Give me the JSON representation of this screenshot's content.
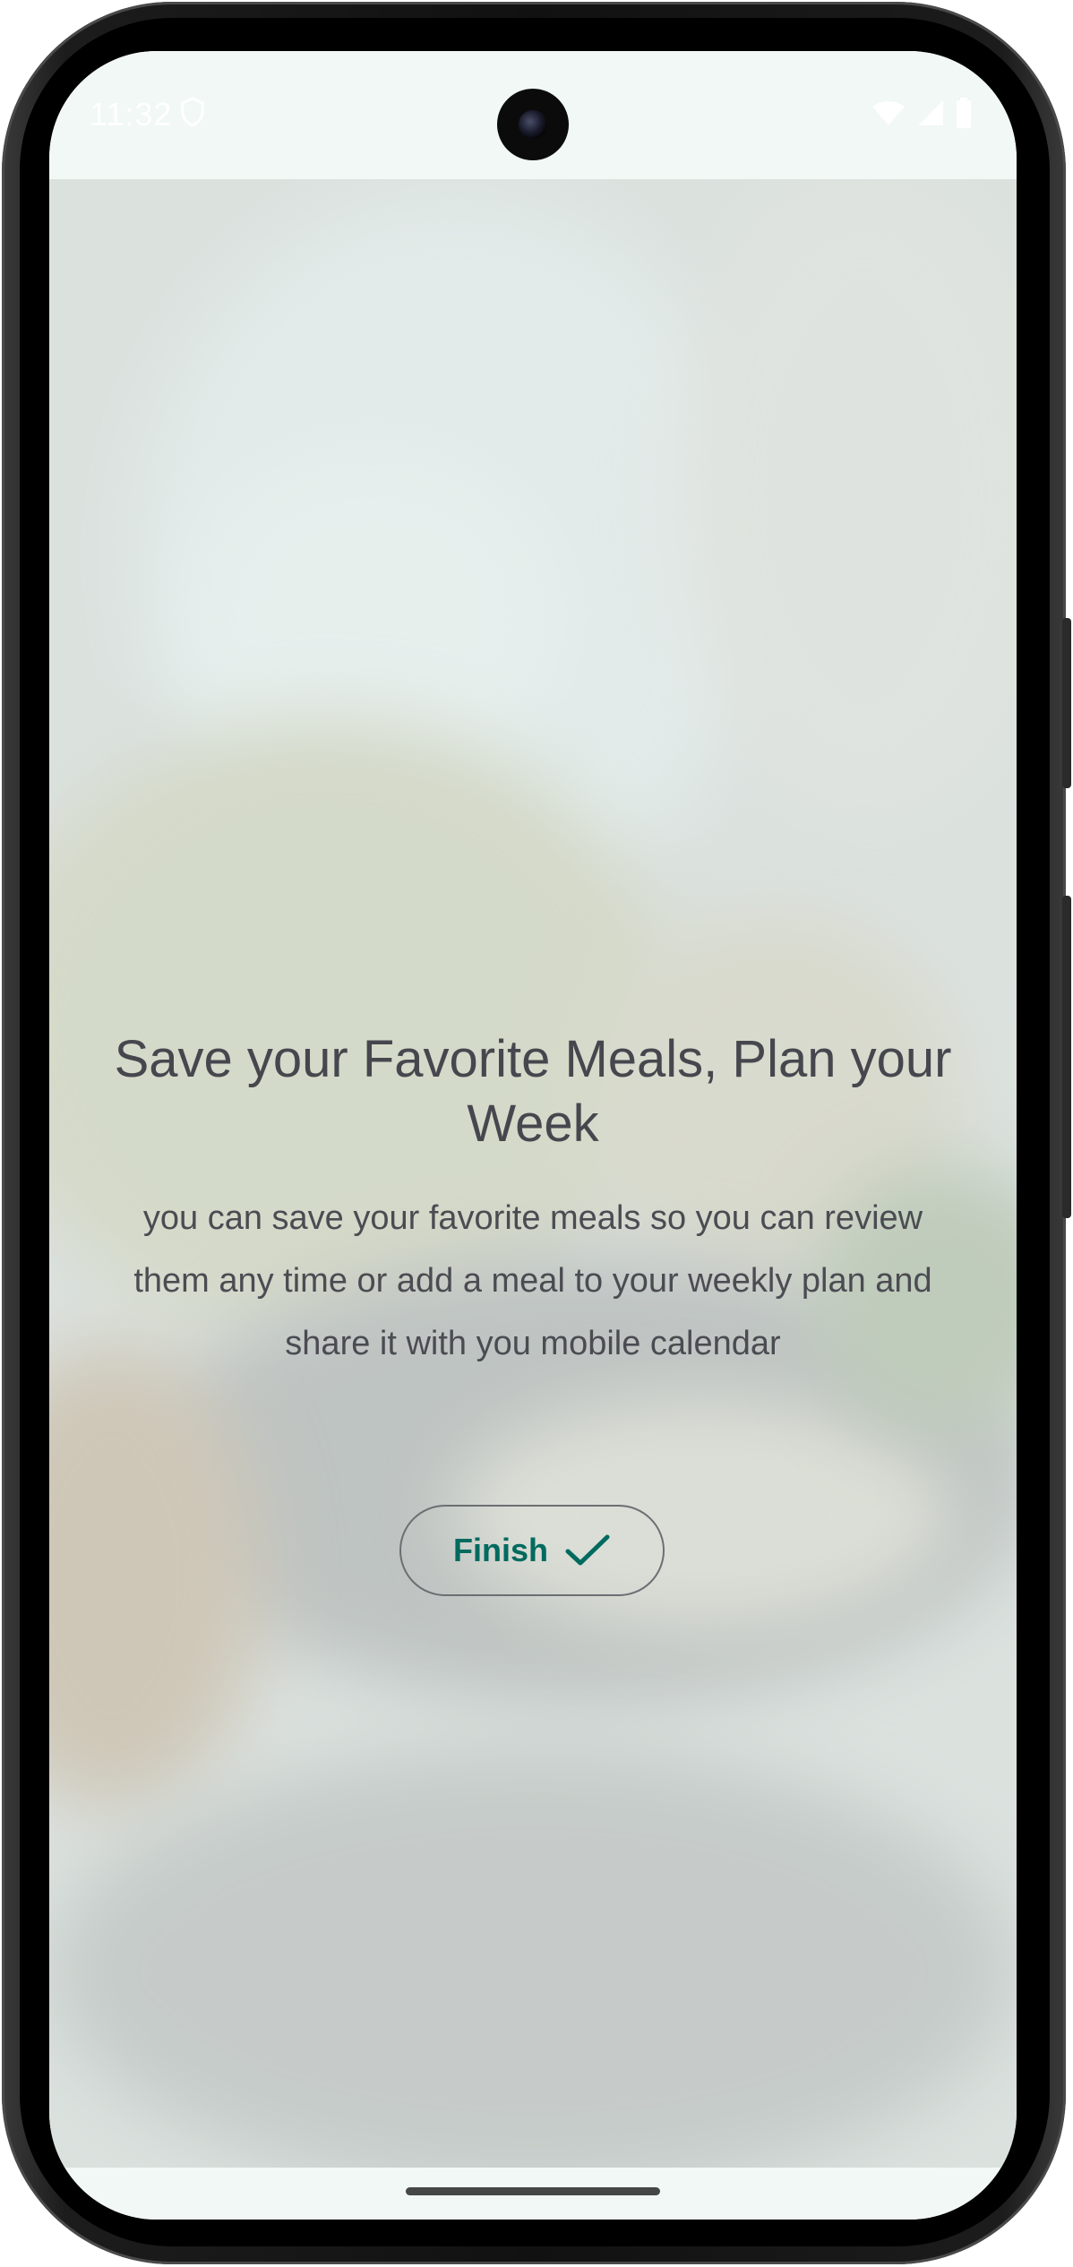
{
  "status_bar": {
    "time": "11:32",
    "icons": [
      "shield-icon",
      "wifi-icon",
      "signal-icon",
      "battery-icon"
    ]
  },
  "onboarding": {
    "title": "Save your Favorite Meals, Plan your Week",
    "description": "you can save your favorite meals so you can review them any time or add a meal to your weekly plan and share it with you mobile calendar",
    "finish_button": {
      "label": "Finish",
      "icon": "check-icon"
    }
  },
  "colors": {
    "accent": "#006a5f",
    "text": "#46474e",
    "surface": "#f1f8f6",
    "outline": "#6b6f73"
  }
}
